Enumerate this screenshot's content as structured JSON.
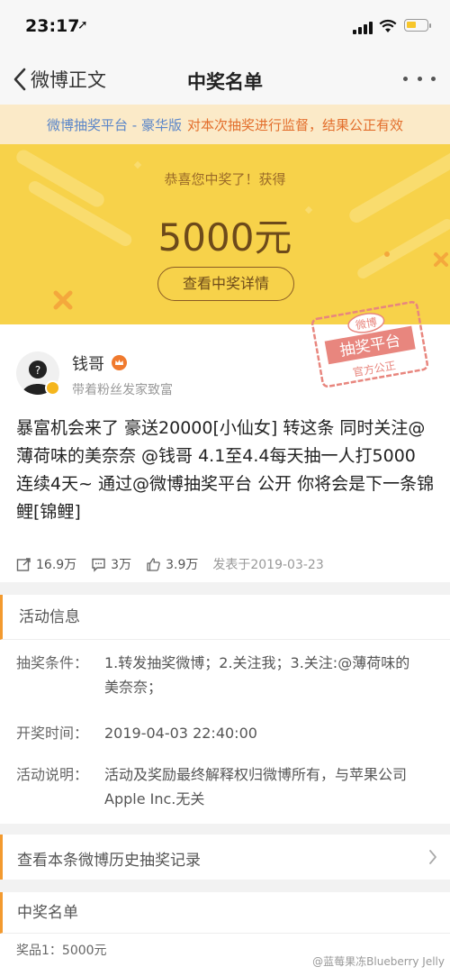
{
  "status_bar": {
    "time": "23:17"
  },
  "nav": {
    "back_label": "微博正文",
    "title": "中奖名单"
  },
  "banner": {
    "platform": "微博抽奖平台 - 豪华版",
    "text": "对本次抽奖进行监督，结果公正有效"
  },
  "prize": {
    "greeting": "恭喜您中奖了！获得",
    "amount": "5000元",
    "button": "查看中奖详情"
  },
  "stamp": {
    "top": "微博",
    "middle": "抽奖平台",
    "bottom": "官方公正"
  },
  "post": {
    "username": "钱哥",
    "description": "带着粉丝发家致富",
    "text": "暴富机会来了 豪送20000[小仙女] 转这条 同时关注@薄荷味的美奈奈 @钱哥 4.1至4.4每天抽一人打5000 连续4天~ 通过@微博抽奖平台 公开 你将会是下一条锦鲤[锦鲤]",
    "reposts": "16.9万",
    "comments": "3万",
    "likes": "3.9万",
    "published": "发表于2019-03-23"
  },
  "activity": {
    "title": "活动信息",
    "conditions_label": "抽奖条件：",
    "conditions_value": "1.转发抽奖微博；2.关注我；3.关注:@薄荷味的美奈奈；",
    "draw_time_label": "开奖时间：",
    "draw_time_value": "2019-04-03 22:40:00",
    "notes_label": "活动说明：",
    "notes_value": "活动及奖励最终解释权归微博所有，与苹果公司Apple Inc.无关"
  },
  "history": {
    "label": "查看本条微博历史抽奖记录"
  },
  "winners": {
    "title": "中奖名单",
    "prize_row": "奖品1：5000元",
    "watermark": "@蓝莓果冻Blueberry Jelly"
  },
  "colors": {
    "accent": "#f39a2f",
    "prize_bg": "#f7d24a",
    "banner_bg": "#fbeac8",
    "link": "#5b86c9"
  }
}
